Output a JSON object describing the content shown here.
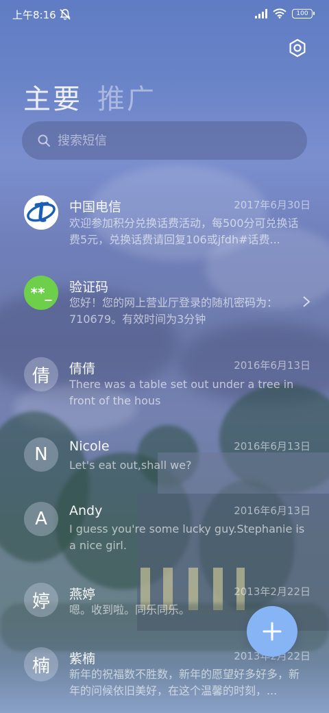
{
  "status_bar": {
    "time": "上午8:16",
    "battery": "100"
  },
  "tabs": [
    {
      "label": "主要",
      "active": true
    },
    {
      "label": "推广",
      "active": false
    }
  ],
  "search": {
    "placeholder": "搜索短信",
    "value": ""
  },
  "conversations": [
    {
      "name": "中国电信",
      "date": "2017年6月30日",
      "preview": "欢迎参加积分兑换话费活动，每500分可兑换话费5元，兑换话费请回复106或jfdh#话费...",
      "avatar": "telecom-logo"
    },
    {
      "name": "验证码",
      "date": "",
      "preview": "您好！您的网上营业厅登录的随机密码为：710679。有效时间为3分钟",
      "avatar_text": "**_",
      "avatar": "green"
    },
    {
      "name": "倩倩",
      "date": "2016年6月13日",
      "preview": "There was a table set out under a tree in front of the hous",
      "avatar_text": "倩"
    },
    {
      "name": "Nicole",
      "date": "2016年6月13日",
      "preview": "Let's eat out,shall we?",
      "avatar_text": "N"
    },
    {
      "name": "Andy",
      "date": "2016年6月13日",
      "preview": "I guess you're some lucky guy.Stephanie is a nice girl.",
      "avatar_text": "A"
    },
    {
      "name": "燕婷",
      "date": "2013年2月22日",
      "preview": "嗯。收到啦。同乐同乐。",
      "avatar_text": "婷"
    },
    {
      "name": "紫楠",
      "date": "2013年2月22日",
      "preview": "新年的祝福数不胜数，新年的愿望好多好多，新年的问候依旧美好，在这个温馨的时刻，...",
      "avatar_text": "楠"
    }
  ],
  "colors": {
    "fab": "#87b4f4",
    "verification_avatar": "#6dcf4a",
    "telecom_blue": "#1b5fb5"
  },
  "icons": [
    "search-icon",
    "settings-icon",
    "chevron-right-icon",
    "plus-icon",
    "wifi-icon",
    "signal-icon",
    "mute-icon",
    "battery-icon"
  ]
}
